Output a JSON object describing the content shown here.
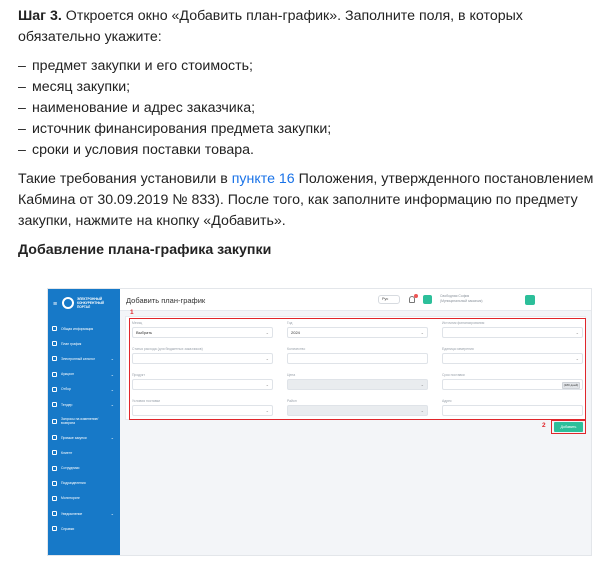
{
  "article": {
    "step_label": "Шаг 3.",
    "step_text": " Откроется окно «Добавить план-график». Заполните поля, в которых обязательно укажите:",
    "list": [
      "предмет закупки и его стоимость;",
      "месяц закупки;",
      "наименование и адрес заказчика;",
      "источник финансирования предмета закупки;",
      "сроки и условия поставки товара."
    ],
    "para_before_link": "Такие требования установили в ",
    "link_text": "пункте 16",
    "para_after_link": " Положения, утвержденного постановлением Кабмина от 30.09.2019 № 833). После того, как заполните информацию по предмету закупки, нажмите на кнопку «Добавить».",
    "heading": "Добавление плана-графика закупки"
  },
  "screenshot": {
    "brand": "ЭЛЕКТРОННЫЙ КОНКУРЕНТНЫЙ ПОРТАЛ",
    "page_title": "Добавить план-график",
    "lang": "Рус",
    "user_name": "Свободная София",
    "user_role": "(Муниципальный заказчик)",
    "sidebar": [
      {
        "label": "Общая информация",
        "chevron": ""
      },
      {
        "label": "План график",
        "chevron": ""
      },
      {
        "label": "Электронный каталог",
        "chevron": "⌄"
      },
      {
        "label": "Аукцион",
        "chevron": "⌄"
      },
      {
        "label": "Отбор",
        "chevron": "⌄"
      },
      {
        "label": "Тендер",
        "chevron": "⌄"
      },
      {
        "label": "Запросы на изменение/ возврата",
        "chevron": ""
      },
      {
        "label": "Прямые закупки",
        "chevron": "⌄"
      },
      {
        "label": "Клиент",
        "chevron": ""
      },
      {
        "label": "Сотрудники",
        "chevron": ""
      },
      {
        "label": "Подразделения",
        "chevron": ""
      },
      {
        "label": "Мониторинг",
        "chevron": ""
      },
      {
        "label": "Уведомление",
        "chevron": "⌄"
      },
      {
        "label": "Справки",
        "chevron": ""
      }
    ],
    "fields": {
      "month_label": "Месяц",
      "month_value": "Выбрать",
      "year_label": "Год",
      "year_value": "2024",
      "source_label": "Источник финансирования",
      "item_label": "Статья расхода (для бюджетных заказчиков)",
      "quantity_label": "Количество",
      "unit_label": "Единица измерения",
      "product_label": "Продукт",
      "price_label": "Цена",
      "total_label": "Срок поставки",
      "days_button": "(180 дней)",
      "terms_label": "Условия поставки",
      "region_label": "Район",
      "address_label": "Адрес"
    },
    "marker_1": "1",
    "marker_2": "2",
    "add_button": "Добавить"
  },
  "colors": {
    "sidebar": "#1779c8",
    "accent": "#2cbf9a",
    "highlight": "#e0262b",
    "link": "#1a73e8"
  }
}
